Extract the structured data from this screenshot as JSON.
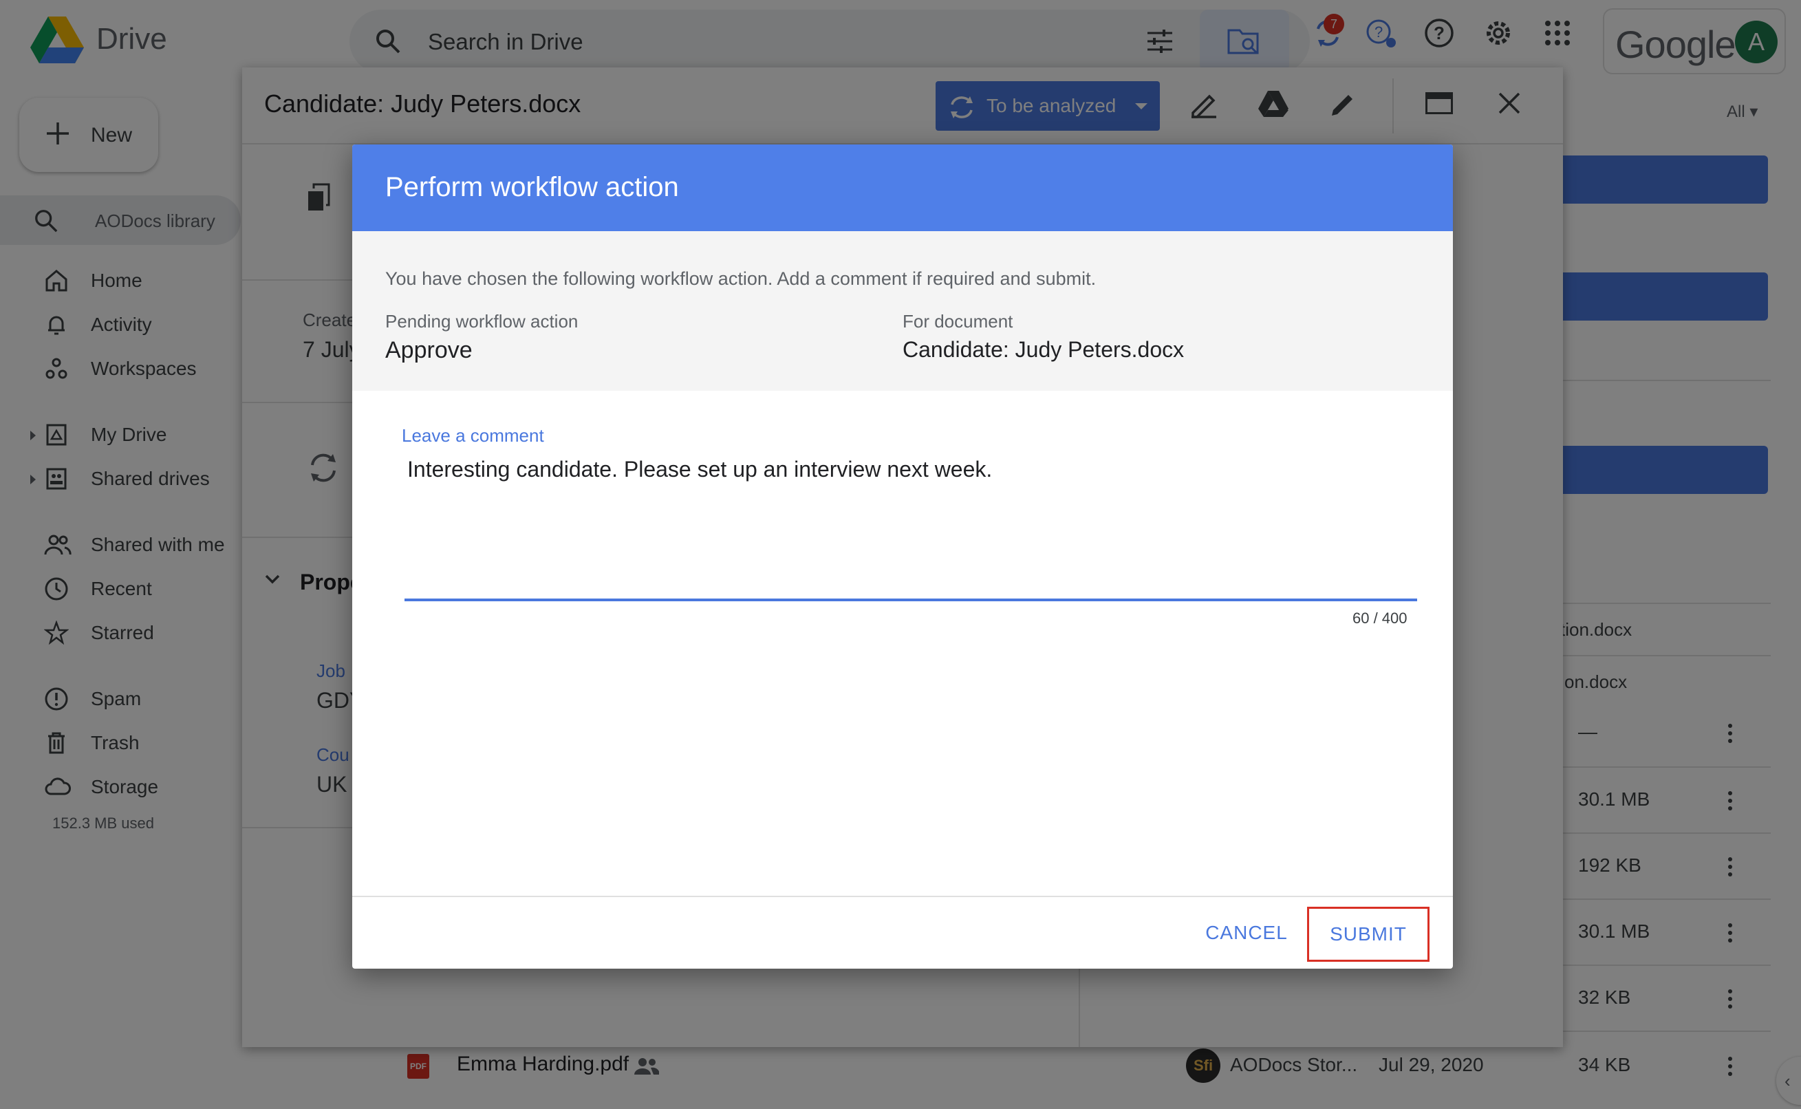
{
  "app": {
    "title": "Drive",
    "search_placeholder": "Search in Drive",
    "notification_count": "7",
    "brand": "Google",
    "avatar_letter": "A"
  },
  "sidebar": {
    "new_label": "New",
    "library_label": "AODocs library",
    "items": [
      {
        "label": "Home",
        "icon": "home-icon"
      },
      {
        "label": "Activity",
        "icon": "bell-icon"
      },
      {
        "label": "Workspaces",
        "icon": "workspaces-icon"
      },
      {
        "label": "My Drive",
        "icon": "my-drive-icon"
      },
      {
        "label": "Shared drives",
        "icon": "shared-drives-icon"
      },
      {
        "label": "Shared with me",
        "icon": "people-icon"
      },
      {
        "label": "Recent",
        "icon": "clock-icon"
      },
      {
        "label": "Starred",
        "icon": "star-icon"
      },
      {
        "label": "Spam",
        "icon": "spam-icon"
      },
      {
        "label": "Trash",
        "icon": "trash-icon"
      },
      {
        "label": "Storage",
        "icon": "cloud-icon"
      }
    ],
    "storage_used": "152.3 MB used"
  },
  "file_list": {
    "filter_label": "All",
    "partial_names": [
      "tion.docx",
      "on.docx"
    ],
    "sizes": [
      "—",
      "30.1 MB",
      "192 KB",
      "30.1 MB",
      "32 KB",
      "34 KB"
    ],
    "bottom_row": {
      "name": "Emma Harding.pdf",
      "file_type": "PDF",
      "owner_initials": "Sfi",
      "owner": "AODocs Stor...",
      "date": "Jul 29, 2020",
      "size": "34 KB"
    }
  },
  "viewer": {
    "title": "Candidate: Judy Peters.docx",
    "status_label": "To be analyzed",
    "created_label": "Create",
    "created_value": "7 July",
    "properties_label": "Prope",
    "job_label": "Job",
    "job_value": "GDY",
    "country_label": "Cou",
    "country_value": "UK"
  },
  "dialog": {
    "title": "Perform workflow action",
    "intro": "You have chosen the following workflow action. Add a comment if required and submit.",
    "pending_label": "Pending workflow action",
    "pending_value": "Approve",
    "document_label": "For document",
    "document_value": "Candidate: Judy Peters.docx",
    "comment_label": "Leave a comment",
    "comment_value": "Interesting candidate. Please set up an interview next week.",
    "char_count": "60 / 400",
    "cancel_label": "CANCEL",
    "submit_label": "SUBMIT"
  },
  "colors": {
    "accent": "#4a78de",
    "dialog_header": "#4f7fe8",
    "highlight": "#d93025"
  }
}
